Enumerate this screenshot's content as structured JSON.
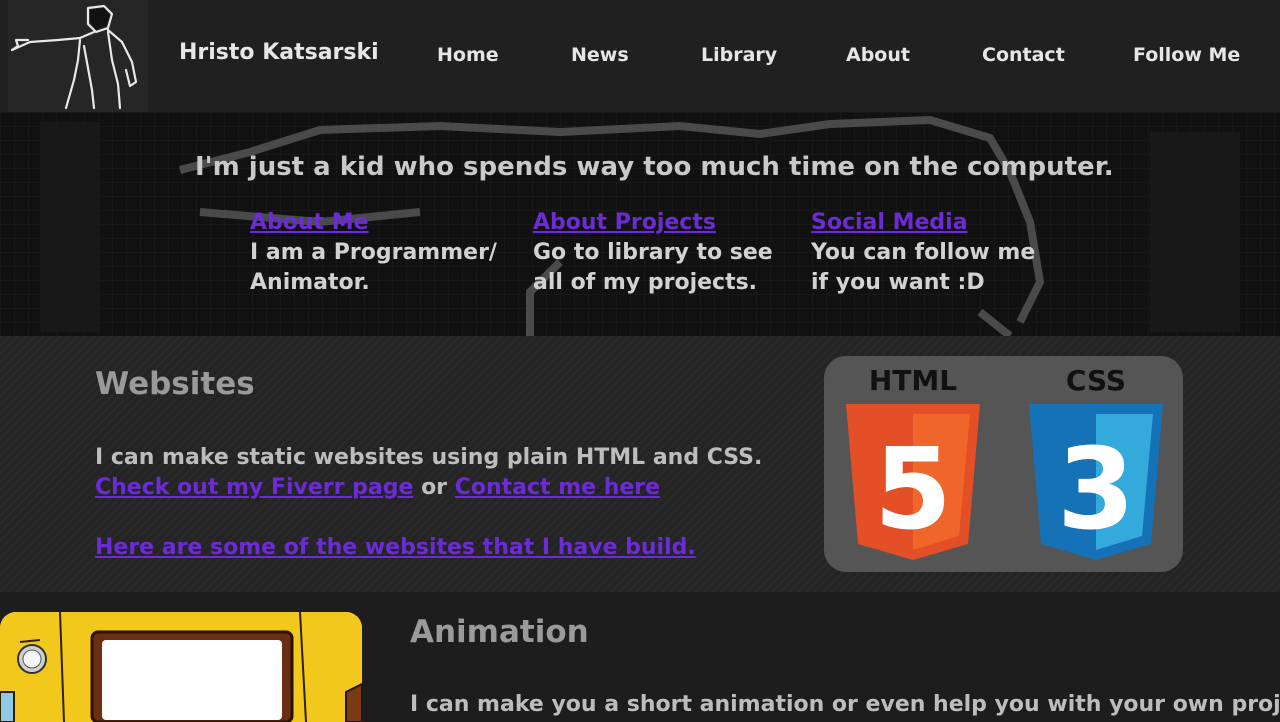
{
  "header": {
    "brand": "Hristo Katsarski",
    "nav": [
      "Home",
      "News",
      "Library",
      "About",
      "Contact",
      "Follow Me"
    ]
  },
  "hero": {
    "tagline": "I'm just a kid who spends way too much time on the computer.",
    "columns": [
      {
        "link": "About Me",
        "text": "I am a Programmer/\nAnimator."
      },
      {
        "link": "About Projects",
        "text": "Go to library to see\nall of my projects."
      },
      {
        "link": "Social Media",
        "text": "You can follow me\nif you want :D"
      }
    ]
  },
  "websites": {
    "title": "Websites",
    "text": "I can make static websites using plain HTML and CSS.",
    "fiverr_link": "Check out my Fiverr page",
    "or": "or",
    "contact_link": "Contact me here",
    "built_link": "Here are some of the websites that I have build.",
    "badges": {
      "html_label": "HTML",
      "html_number": "5",
      "css_label": "CSS",
      "css_number": "3",
      "html_color": "#e34f26",
      "css_color": "#1572b6"
    }
  },
  "animation": {
    "title": "Animation",
    "text": "I can make you a short animation or even help you with your own project."
  },
  "colors": {
    "link": "#6b2bd6",
    "background": "#1c1c1c",
    "animation_thumb": "#f3c81c"
  }
}
